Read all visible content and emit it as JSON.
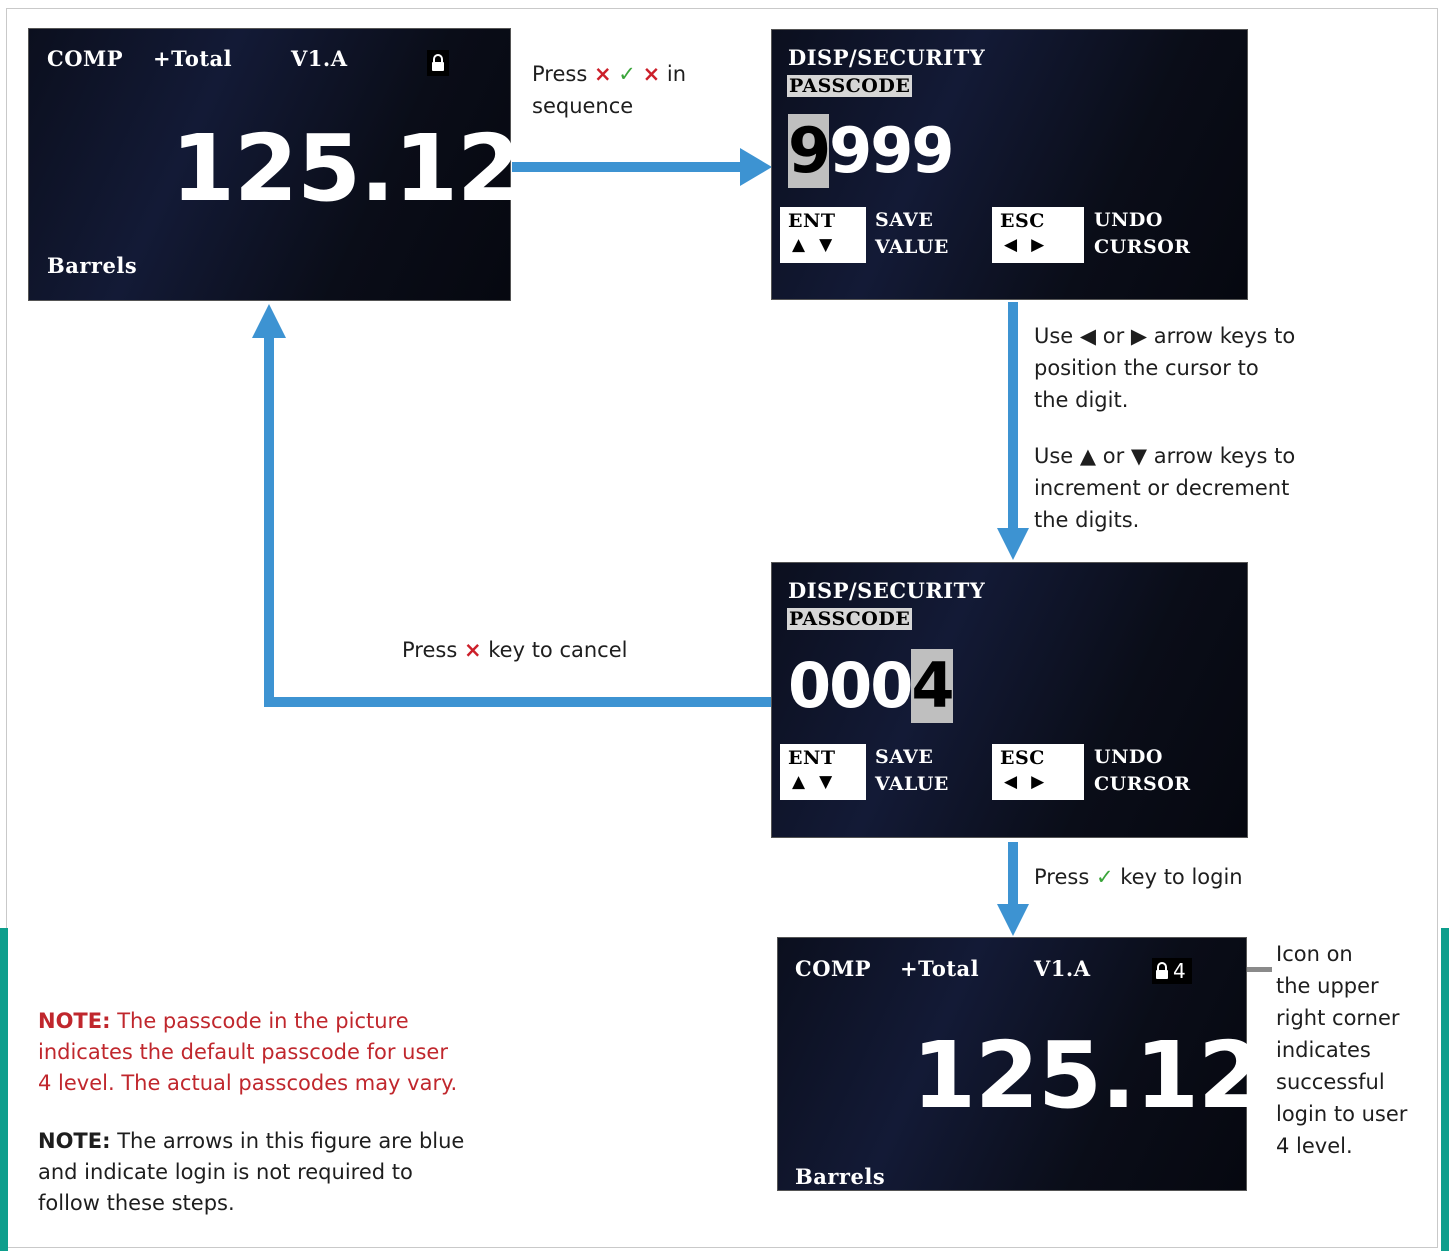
{
  "screen1": {
    "status": [
      "COMP",
      "+Total",
      "V1.A"
    ],
    "value": "125.12",
    "unit": "Barrels"
  },
  "screen2": {
    "title": "DISP/SECURITY",
    "subtitle": "PASSCODE",
    "digits": [
      "9",
      "9",
      "9",
      "9"
    ],
    "cursor_index": 0,
    "keys": {
      "ent": "ENT",
      "ent_arrows": "▲▼",
      "ent_label_1": "SAVE",
      "ent_label_2": "VALUE",
      "esc": "ESC",
      "esc_arrows": "◀▶",
      "esc_label_1": "UNDO",
      "esc_label_2": "CURSOR"
    }
  },
  "screen3": {
    "title": "DISP/SECURITY",
    "subtitle": "PASSCODE",
    "digits": [
      "0",
      "0",
      "0",
      "4"
    ],
    "cursor_index": 3,
    "keys": {
      "ent": "ENT",
      "ent_arrows": "▲▼",
      "ent_label_1": "SAVE",
      "ent_label_2": "VALUE",
      "esc": "ESC",
      "esc_arrows": "◀▶",
      "esc_label_1": "UNDO",
      "esc_label_2": "CURSOR"
    }
  },
  "screen4": {
    "status": [
      "COMP",
      "+Total",
      "V1.A"
    ],
    "user_level": "4",
    "value": "125.12",
    "unit": "Barrels"
  },
  "captions": {
    "press_seq_1": "Press",
    "press_seq_x1": "×",
    "press_seq_ok": "✓",
    "press_seq_x2": "×",
    "press_seq_2": "in",
    "press_seq_3": "sequence",
    "cursor_1": "Use ◀ or ▶ arrow keys to",
    "cursor_2": "position the cursor to",
    "cursor_3": "the digit.",
    "incr_1": "Use ▲ or ▼ arrow keys to",
    "incr_2": "increment or decrement",
    "incr_3": "the digits.",
    "cancel_pre": "Press",
    "cancel_x": "×",
    "cancel_post": "key to cancel",
    "login_pre": "Press",
    "login_ok": "✓",
    "login_post": "key to login",
    "icon_note": [
      "Icon on",
      "the upper",
      "right corner",
      "indicates",
      "successful",
      "login to user",
      "4 level."
    ]
  },
  "notes": {
    "note1_label": "NOTE:",
    "note1_l1": "The passcode in the picture",
    "note1_l2": "indicates the default passcode for user",
    "note1_l3": "4 level. The actual passcodes may vary.",
    "note2_label": "NOTE:",
    "note2_l1": "The arrows in this figure are blue",
    "note2_l2": "and indicate login is not required to",
    "note2_l3": "follow these steps."
  },
  "colors": {
    "arrow": "#3d93d2",
    "note_red": "#c0272d",
    "teal_bar": "#0d9e8c",
    "x_key": "#cc1f2a",
    "ok_key": "#3aa53a"
  }
}
